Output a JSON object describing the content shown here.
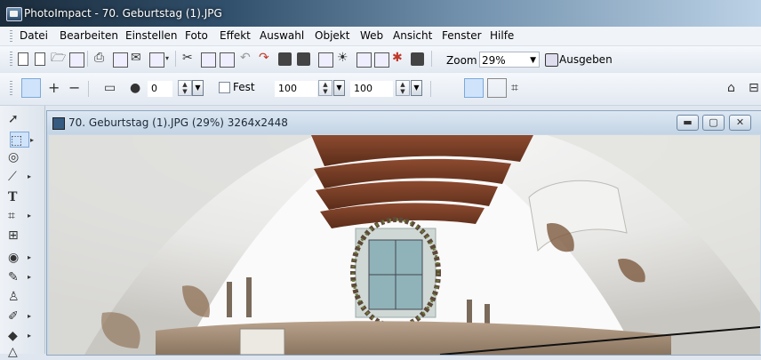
{
  "app": {
    "title": "PhotoImpact - 70. Geburtstag  (1).JPG"
  },
  "menu": {
    "items": [
      "Datei",
      "Bearbeiten",
      "Einstellen",
      "Foto",
      "Effekt",
      "Auswahl",
      "Objekt",
      "Web",
      "Ansicht",
      "Fenster",
      "Hilfe"
    ]
  },
  "toolbar": {
    "zoom_label": "Zoom",
    "zoom_value": "29%",
    "ausgeben_label": "Ausgeben"
  },
  "attribute_bar": {
    "plus_label": "+",
    "minus_label": "−",
    "soft_edge_value": "0",
    "fest_label": "Fest",
    "width_value": "100",
    "height_value": "100"
  },
  "document": {
    "title": "70. Geburtstag  (1).JPG (29%) 3264x2448"
  },
  "icons": [
    "new-icon",
    "open-icon",
    "save-icon",
    "print-icon",
    "scan-icon",
    "mail-icon",
    "cut-icon",
    "copy-icon",
    "paste-icon",
    "undo-icon",
    "redo-icon",
    "camera-icon",
    "pointer-icon",
    "selection-icon",
    "lasso-icon",
    "text-icon",
    "crop-icon",
    "transform-icon",
    "paint-icon",
    "clone-icon",
    "eraser-icon"
  ],
  "colors": {
    "title_bar": "#31506c",
    "toolbar_bg": "#e3e9f1",
    "doc_frame": "#c3d4e5",
    "selected_tool": "#cfe3fb"
  }
}
